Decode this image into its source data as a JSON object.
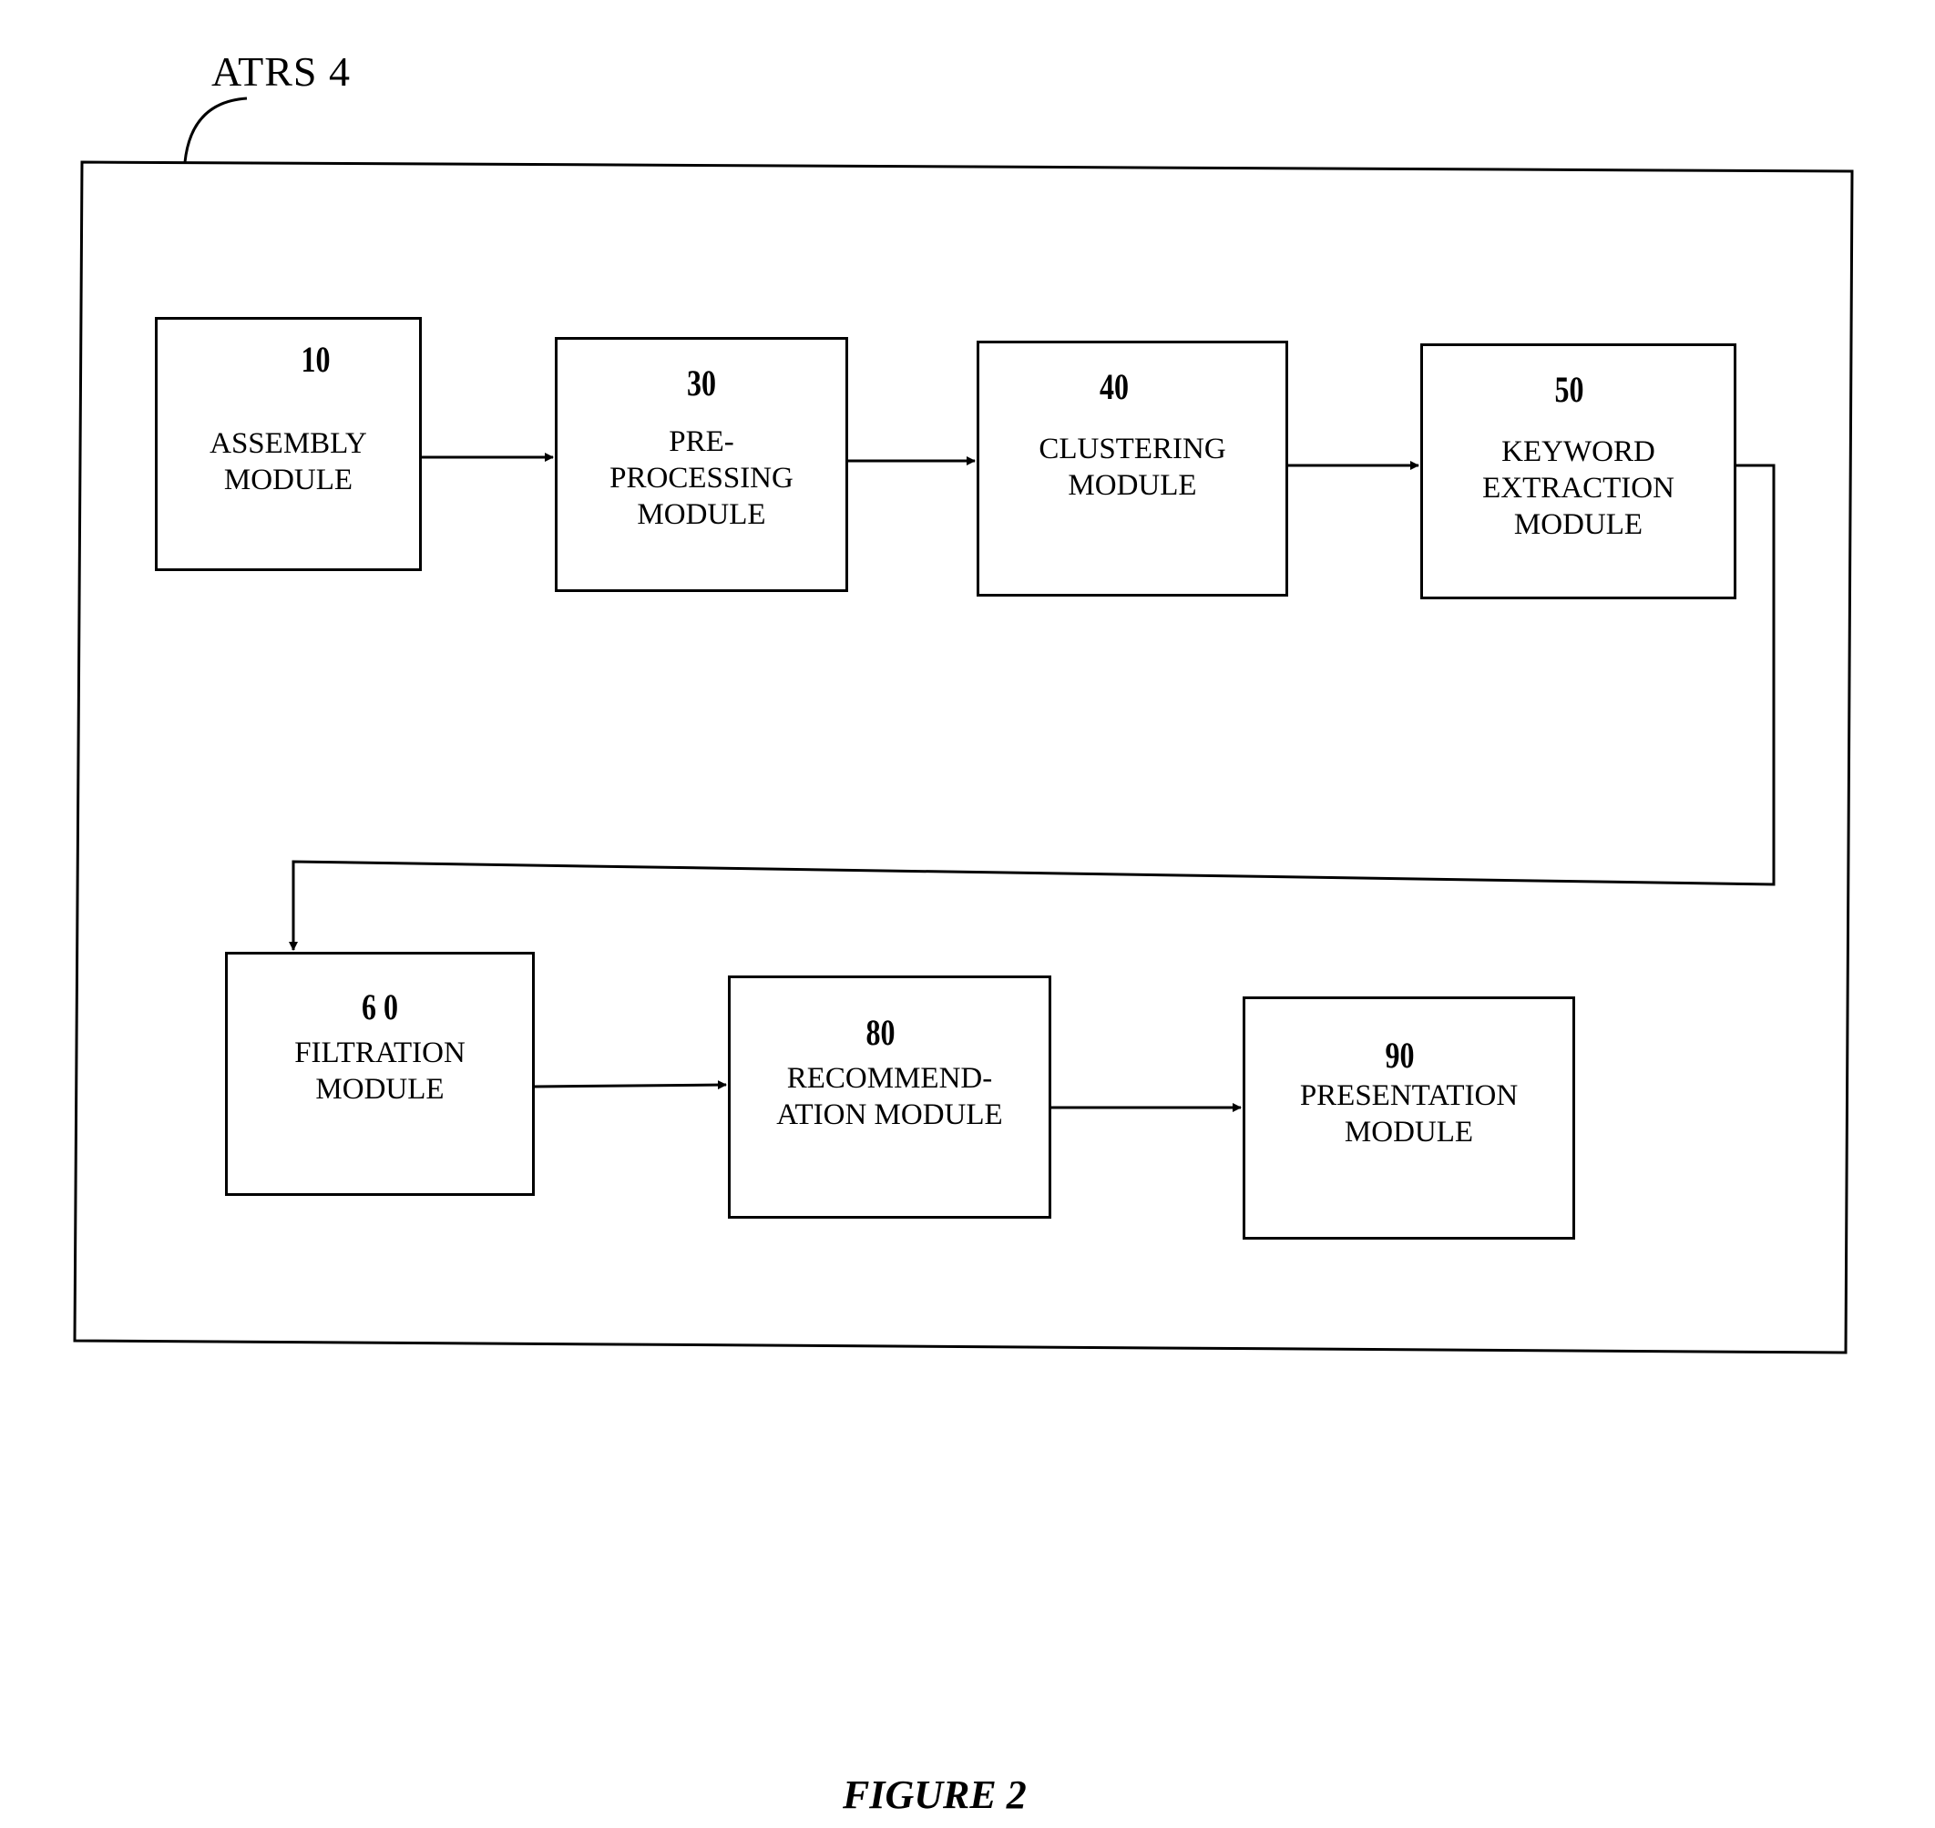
{
  "system_label": "ATRS 4",
  "modules": [
    {
      "id": "10",
      "label": "ASSEMBLY\nMODULE"
    },
    {
      "id": "30",
      "label": "PRE-\nPROCESSING\nMODULE"
    },
    {
      "id": "40",
      "label": "CLUSTERING\nMODULE"
    },
    {
      "id": "50",
      "label": "KEYWORD\nEXTRACTION\nMODULE"
    },
    {
      "id": "6 0",
      "label": "FILTRATION\nMODULE"
    },
    {
      "id": "80",
      "label": "RECOMMEND-\nATION MODULE"
    },
    {
      "id": "90",
      "label": "PRESENTATION\nMODULE"
    }
  ],
  "flow": [
    [
      "10",
      "30"
    ],
    [
      "30",
      "40"
    ],
    [
      "40",
      "50"
    ],
    [
      "50",
      "6 0"
    ],
    [
      "6 0",
      "80"
    ],
    [
      "80",
      "90"
    ]
  ],
  "caption": "FIGURE 2"
}
